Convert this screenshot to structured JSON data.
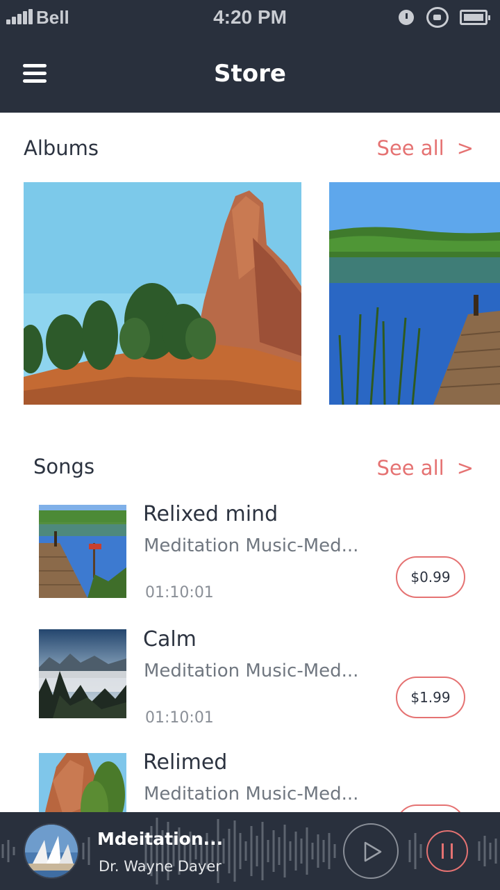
{
  "status_bar": {
    "carrier": "Bell",
    "time": "4:20 PM"
  },
  "nav": {
    "title": "Store",
    "menu_icon": "hamburger-menu-icon"
  },
  "albums": {
    "title": "Albums",
    "see_all": "See all",
    "chevron": ">",
    "items": [
      {
        "image": "red-rock-spire-landscape"
      },
      {
        "image": "lake-with-wooden-pier"
      }
    ]
  },
  "songs": {
    "title": "Songs",
    "see_all": "See all",
    "chevron": ">",
    "items": [
      {
        "title": "Relixed mind",
        "artist": "Meditation Music-Med...",
        "duration": "01:10:01",
        "price": "$0.99",
        "image": "lake-pier-thumbnail"
      },
      {
        "title": "Calm",
        "artist": "Meditation Music-Med...",
        "duration": "01:10:01",
        "price": "$1.99",
        "image": "misty-mountains-thumbnail"
      },
      {
        "title": "Relimed",
        "artist": "Meditation Music-Med...",
        "duration": "",
        "price": "",
        "image": "red-rock-thumbnail"
      }
    ]
  },
  "player": {
    "title": "Mdeitation...",
    "artist": "Dr. Wayne Dayer",
    "accent": "#e57272",
    "background": "#29303d"
  }
}
